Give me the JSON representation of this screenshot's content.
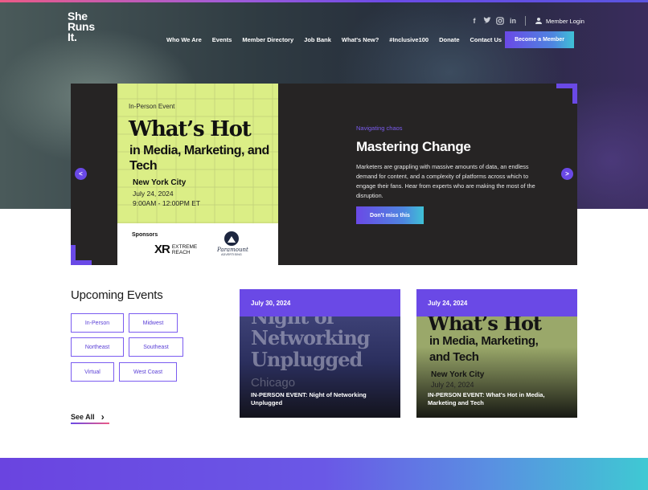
{
  "logo": {
    "line1": "She",
    "line2": "Runs",
    "line3": "It."
  },
  "social": {
    "facebook": "f",
    "twitter": "t",
    "instagram": "◎",
    "linkedin": "in"
  },
  "header": {
    "member_login": "Member Login",
    "become_member": "Become a Member"
  },
  "nav": {
    "items": [
      "Who We Are",
      "Events",
      "Member Directory",
      "Job Bank",
      "What's New?",
      "#Inclusive100",
      "Donate",
      "Contact Us"
    ]
  },
  "slide": {
    "event_type": "In-Person Event",
    "headline": "What’s Hot",
    "subhead": "in Media, Marketing, and Tech",
    "city": "New York City",
    "date": "July 24, 2024",
    "time": "9:00AM - 12:00PM ET",
    "sponsors_label": "Sponsors",
    "sponsor1_mark": "XR",
    "sponsor1_line1": "EXTREME",
    "sponsor1_line2": "REACH",
    "sponsor2_name": "Paramount",
    "sponsor2_sub": "ADVERTISING",
    "eyebrow": "Navigating chaos",
    "title": "Mastering Change",
    "description": "Marketers are grappling with massive amounts of data, an endless demand for content, and a complexity of platforms across which to engage their fans. Hear from experts who are making the most of the disruption.",
    "cta": "Don't miss this",
    "prev": "<",
    "next": ">"
  },
  "upcoming": {
    "title": "Upcoming Events",
    "tags": [
      "In-Person",
      "Midwest",
      "Northeast",
      "Southeast",
      "Virtual",
      "West Coast"
    ],
    "see_all": "See All",
    "see_all_chevron": "›"
  },
  "events": [
    {
      "date": "July 30, 2024",
      "art_line1": "Night of",
      "art_line2": "Networking",
      "art_line3": "Unplugged",
      "art_city": "Chicago",
      "caption": "IN-PERSON EVENT: Night of Networking Unplugged"
    },
    {
      "date": "July 24, 2024",
      "art_line1": "What’s Hot",
      "art_line2": "in Media, Marketing,",
      "art_line3": "and Tech",
      "art_city": "New York City",
      "art_date": "July 24, 2024",
      "caption": "IN-PERSON EVENT: What's Hot in Media, Marketing and Tech"
    }
  ],
  "colors": {
    "accent": "#6a49e6",
    "teal": "#3fc1d6",
    "lime": "#dbee86",
    "dark": "#262424"
  }
}
